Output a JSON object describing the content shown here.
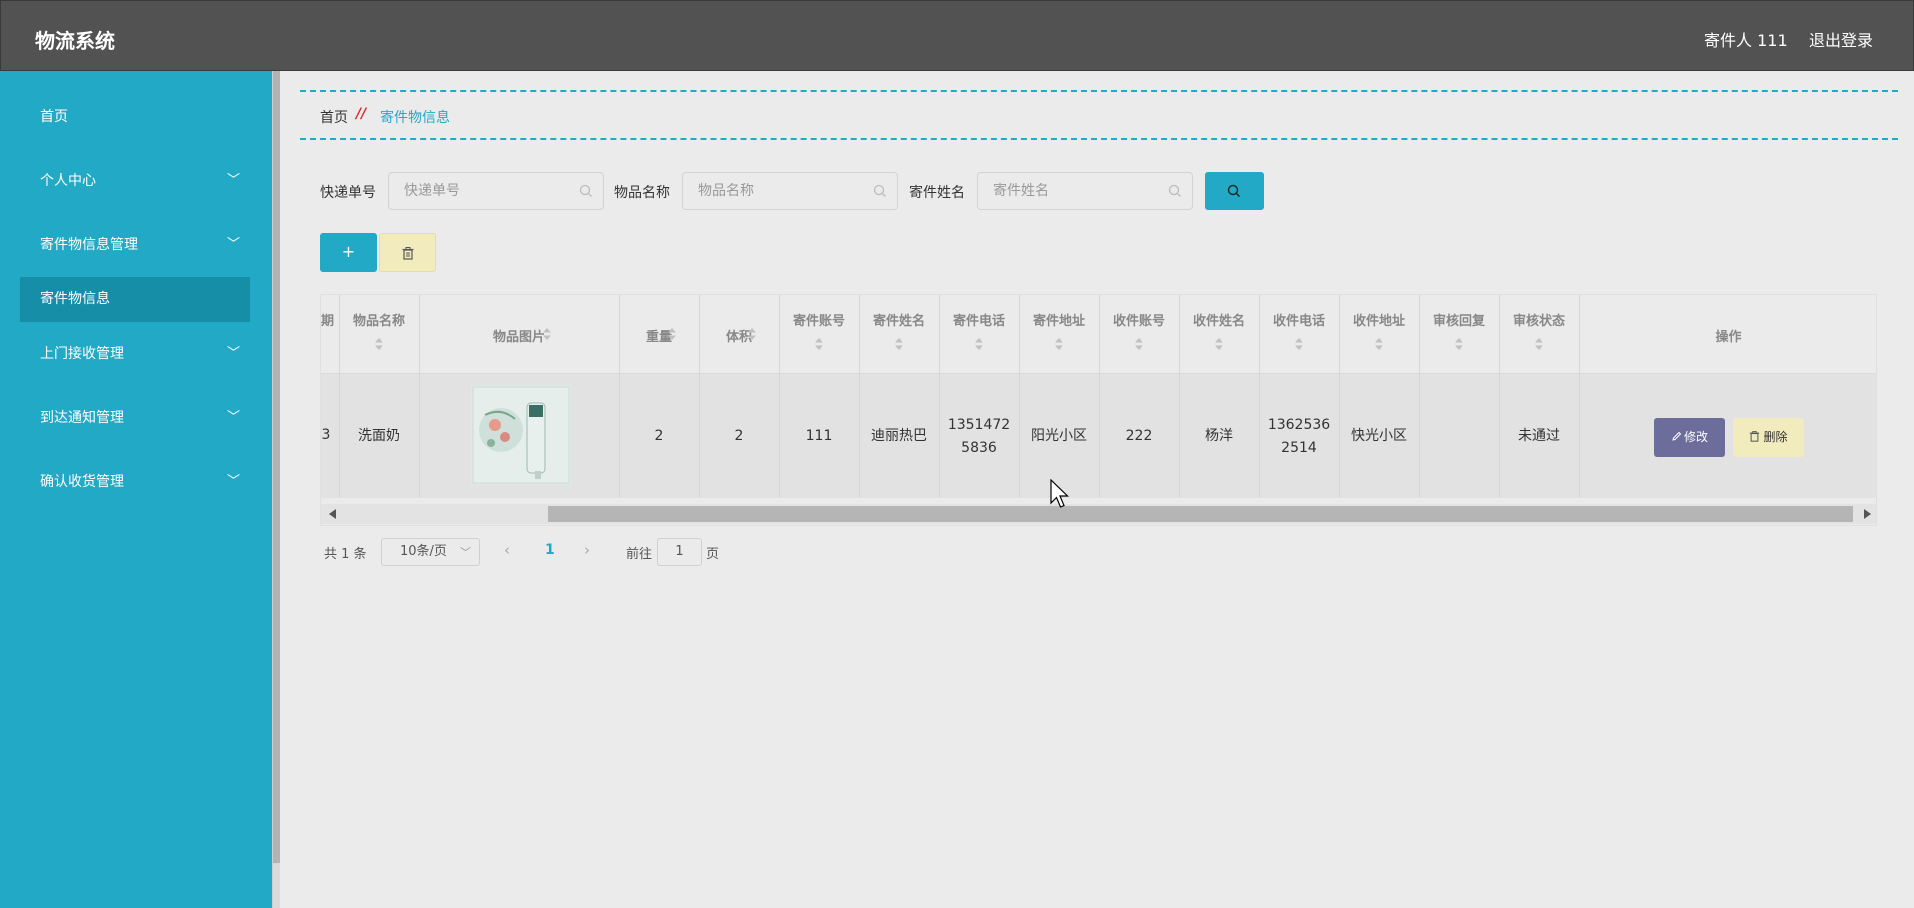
{
  "header": {
    "title": "物流系统",
    "user": "寄件人 111",
    "logout": "退出登录"
  },
  "sidebar": {
    "items": [
      {
        "label": "首页"
      },
      {
        "label": "个人中心"
      },
      {
        "label": "寄件物信息管理"
      },
      {
        "label": "寄件物信息"
      },
      {
        "label": "上门接收管理"
      },
      {
        "label": "到达通知管理"
      },
      {
        "label": "确认收货管理"
      }
    ],
    "active": "寄件物信息"
  },
  "breadcrumb": {
    "home": "首页",
    "separator": "//",
    "current": "寄件物信息"
  },
  "filters": [
    {
      "label": "快递单号",
      "placeholder": "快递单号"
    },
    {
      "label": "物品名称",
      "placeholder": "物品名称"
    },
    {
      "label": "寄件姓名",
      "placeholder": "寄件姓名"
    }
  ],
  "table": {
    "headers": [
      "期",
      "物品名称",
      "物品图片",
      "重量",
      "体积",
      "寄件账号",
      "寄件姓名",
      "寄件电话",
      "寄件地址",
      "收件账号",
      "收件姓名",
      "收件电话",
      "收件地址",
      "审核回复",
      "审核状态",
      "操作"
    ],
    "rows": [
      {
        "partial": "3",
        "name": "洗面奶",
        "image": "facial-cleanser-product-photo",
        "weight": "2",
        "volume": "2",
        "sender_account": "111",
        "sender_name": "迪丽热巴",
        "sender_phone_1": "1351472",
        "sender_phone_2": "5836",
        "sender_address": "阳光小区",
        "receiver_account": "222",
        "receiver_name": "杨洋",
        "receiver_phone_1": "1362536",
        "receiver_phone_2": "2514",
        "receiver_address": "快光小区",
        "review_reply": "",
        "review_status": "未通过"
      }
    ],
    "actions": {
      "edit": "修改",
      "delete": "删除"
    }
  },
  "pagination": {
    "total": "共 1 条",
    "page_size": "10条/页",
    "current_page": "1",
    "goto": "前往",
    "goto_value": "1",
    "unit": "页"
  },
  "colors": {
    "accent": "#22a9c5",
    "topbar": "#525252",
    "edit": "#6d6d9c",
    "delete": "#f2ebbd",
    "breadcrumb_sep": "#d5302b"
  }
}
